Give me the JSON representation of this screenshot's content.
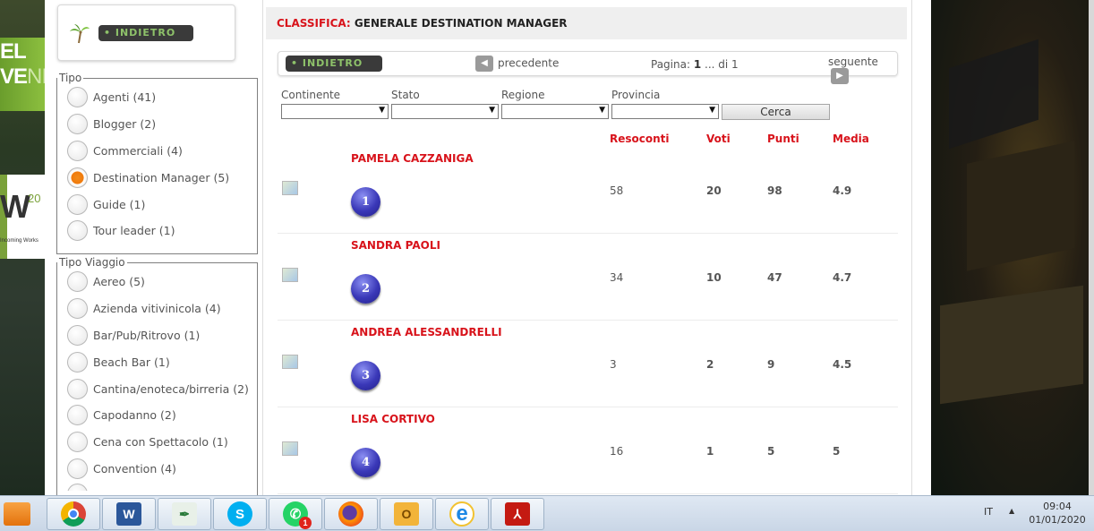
{
  "background": {
    "left_banner_line1": "EL",
    "left_banner_line2_a": "VE",
    "left_banner_line2_b": "NI",
    "left_logo_letter": "W",
    "left_logo_sup": "20",
    "left_logo_small": "Incoming Works"
  },
  "sidebar": {
    "back_label": "INDIETRO",
    "groups": [
      {
        "legend": "Tipo",
        "options": [
          {
            "label": "Agenti (41)",
            "selected": false
          },
          {
            "label": "Blogger (2)",
            "selected": false
          },
          {
            "label": "Commerciali (4)",
            "selected": false
          },
          {
            "label": "Destination Manager (5)",
            "selected": true
          },
          {
            "label": "Guide (1)",
            "selected": false
          },
          {
            "label": "Tour leader (1)",
            "selected": false
          }
        ]
      },
      {
        "legend": "Tipo Viaggio",
        "options": [
          {
            "label": "Aereo (5)",
            "selected": false
          },
          {
            "label": "Azienda vitivinicola (4)",
            "selected": false
          },
          {
            "label": "Bar/Pub/Ritrovo (1)",
            "selected": false
          },
          {
            "label": "Beach Bar (1)",
            "selected": false
          },
          {
            "label": "Cantina/enoteca/birreria (2)",
            "selected": false
          },
          {
            "label": "Capodanno (2)",
            "selected": false
          },
          {
            "label": "Cena con Spettacolo (1)",
            "selected": false
          },
          {
            "label": "Convention (4)",
            "selected": false
          }
        ]
      }
    ]
  },
  "main": {
    "title_prefix": "CLASSIFICA:",
    "title_text": "GENERALE DESTINATION MANAGER",
    "pager": {
      "back_label": "INDIETRO",
      "prev_label": "precedente",
      "page_label": "Pagina:",
      "page_current": "1",
      "page_of": "... di 1",
      "next_label": "seguente"
    },
    "filters": {
      "continente": "Continente",
      "stato": "Stato",
      "regione": "Regione",
      "provincia": "Provincia",
      "search_button": "Cerca"
    },
    "columns": {
      "resoconti": "Resoconti",
      "voti": "Voti",
      "punti": "Punti",
      "media": "Media"
    },
    "rows": [
      {
        "rank": "1",
        "name": "PAMELA CAZZANIGA",
        "resoconti": "58",
        "voti": "20",
        "punti": "98",
        "media": "4.9"
      },
      {
        "rank": "2",
        "name": "SANDRA PAOLI",
        "resoconti": "34",
        "voti": "10",
        "punti": "47",
        "media": "4.7"
      },
      {
        "rank": "3",
        "name": "ANDREA ALESSANDRELLI",
        "resoconti": "3",
        "voti": "2",
        "punti": "9",
        "media": "4.5"
      },
      {
        "rank": "4",
        "name": "LISA CORTIVO",
        "resoconti": "16",
        "voti": "1",
        "punti": "5",
        "media": "5"
      }
    ]
  },
  "taskbar": {
    "apps": [
      "chrome-icon",
      "word-icon",
      "quill-icon",
      "skype-icon",
      "whatsapp-icon",
      "firefox-icon",
      "outlook-icon",
      "ie-icon",
      "acrobat-icon"
    ],
    "whatsapp_badge": "1",
    "lang": "IT",
    "time": "09:04",
    "date": "01/01/2020"
  }
}
